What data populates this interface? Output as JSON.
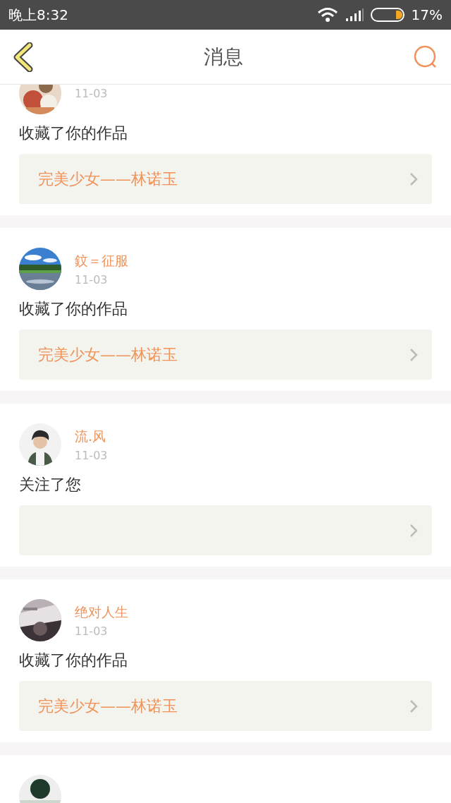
{
  "status_bar": {
    "time": "晚上8:32",
    "battery_percent": "17%"
  },
  "header": {
    "title": "消息"
  },
  "messages": [
    {
      "kind": "message",
      "date": "11-03",
      "action": "收藏了你的作品",
      "work": "完美少女——林诺玉"
    },
    {
      "kind": "message",
      "name": "鈫＝征服",
      "date": "11-03",
      "action": "收藏了你的作品",
      "work": "完美少女——林诺玉"
    },
    {
      "kind": "message",
      "name": "流.风",
      "date": "11-03",
      "action": "关注了您"
    },
    {
      "kind": "message",
      "name": "绝对人生",
      "date": "11-03",
      "action": "收藏了你的作品",
      "work": "完美少女——林诺玉"
    },
    {
      "kind": "picture"
    }
  ]
}
